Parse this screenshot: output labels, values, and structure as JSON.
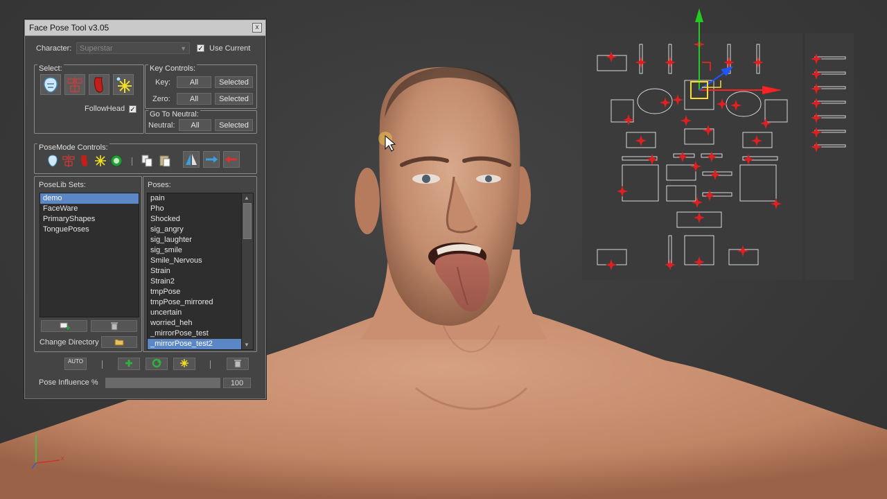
{
  "window": {
    "title": "Face Pose Tool v3.05",
    "close_glyph": "x"
  },
  "character": {
    "label": "Character:",
    "value": "Superstar",
    "use_current_label": "Use Current",
    "use_current_checked": true
  },
  "select": {
    "label": "Select:",
    "follow_head_label": "FollowHead",
    "follow_head_checked": true,
    "icons": [
      "face-mask-icon",
      "controls-layout-icon",
      "tongue-icon",
      "star-sparkle-icon"
    ]
  },
  "key_controls": {
    "label": "Key Controls:",
    "key_label": "Key:",
    "zero_label": "Zero:",
    "all_label": "All",
    "selected_label": "Selected"
  },
  "go_to_neutral": {
    "label": "Go To Neutral:",
    "neutral_label": "Neutral:",
    "all_label": "All",
    "selected_label": "Selected"
  },
  "posemode": {
    "label": "PoseMode Controls:",
    "icons": [
      "face-mask-icon",
      "controls-layout-icon",
      "tongue-icon",
      "star-sparkle-icon",
      "target-icon",
      "copy-icon",
      "paste-icon",
      "mirror-icon",
      "mirror-right-icon",
      "mirror-left-icon"
    ]
  },
  "poselib": {
    "label": "PoseLib Sets:",
    "items": [
      "demo",
      "FaceWare",
      "PrimaryShapes",
      "TonguePoses"
    ],
    "selected_index": 0,
    "change_directory_label": "Change Directory"
  },
  "poses": {
    "label": "Poses:",
    "items": [
      "pain",
      "Pho",
      "Shocked",
      "sig_angry",
      "sig_laughter",
      "sig_smile",
      "Smile_Nervous",
      "Strain",
      "Strain2",
      "tmpPose",
      "tmpPose_mirrored",
      "uncertain",
      "worried_heh",
      "_mirrorPose_test",
      "_mirrorPose_test2"
    ],
    "selected_index": 14
  },
  "bottom_toolbar": {
    "auto_label": "AUTO",
    "icons": [
      "auto-key-icon",
      "add-icon",
      "refresh-icon",
      "sparkle-icon",
      "delete-icon"
    ]
  },
  "influence": {
    "label": "Pose Influence %",
    "value": "100",
    "fraction": 1.0
  },
  "colors": {
    "selection": "#5b87c7",
    "window_bg": "#444444",
    "viewport_bg": "#383838",
    "control_red": "#e02020"
  }
}
